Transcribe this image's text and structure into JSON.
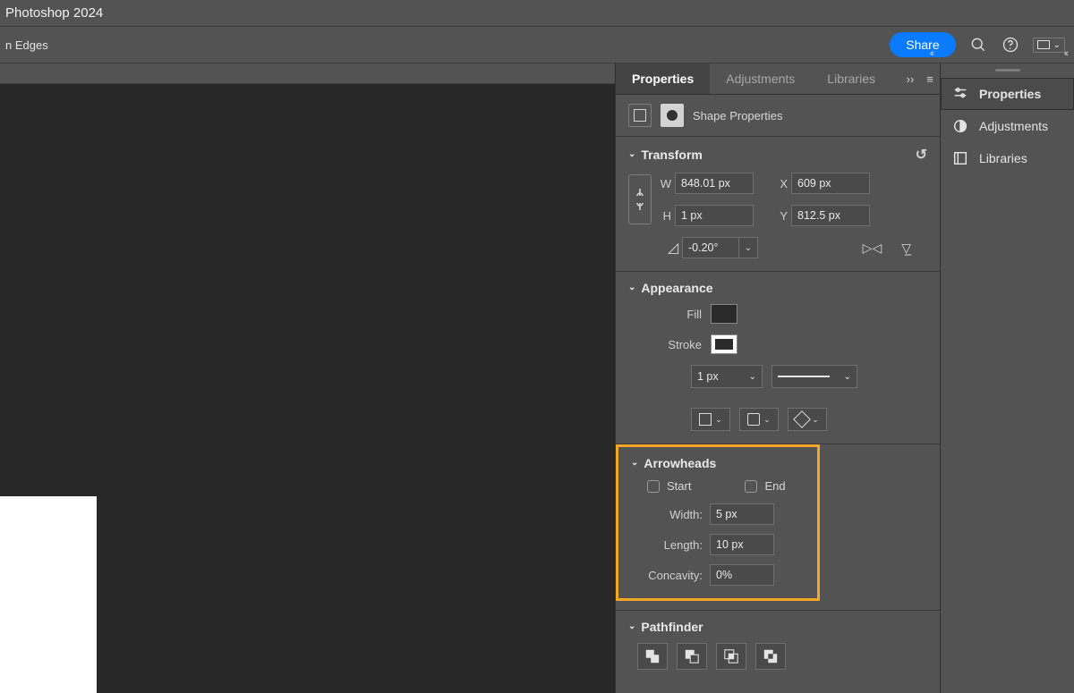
{
  "app": {
    "title": "Photoshop 2024"
  },
  "optionsbar": {
    "left_label": "n Edges",
    "share_label": "Share"
  },
  "panel": {
    "tabs": {
      "properties": "Properties",
      "adjustments": "Adjustments",
      "libraries": "Libraries"
    },
    "subhead": "Shape Properties",
    "transform": {
      "title": "Transform",
      "w_label": "W",
      "w": "848.01 px",
      "h_label": "H",
      "h": "1 px",
      "x_label": "X",
      "x": "609 px",
      "y_label": "Y",
      "y": "812.5 px",
      "rotation": "-0.20°"
    },
    "appearance": {
      "title": "Appearance",
      "fill_label": "Fill",
      "stroke_label": "Stroke",
      "stroke_width": "1 px"
    },
    "arrowheads": {
      "title": "Arrowheads",
      "start_label": "Start",
      "end_label": "End",
      "width_label": "Width:",
      "width": "5 px",
      "length_label": "Length:",
      "length": "10 px",
      "concavity_label": "Concavity:",
      "concavity": "0%"
    },
    "pathfinder": {
      "title": "Pathfinder"
    }
  },
  "dock": {
    "properties": "Properties",
    "adjustments": "Adjustments",
    "libraries": "Libraries"
  }
}
